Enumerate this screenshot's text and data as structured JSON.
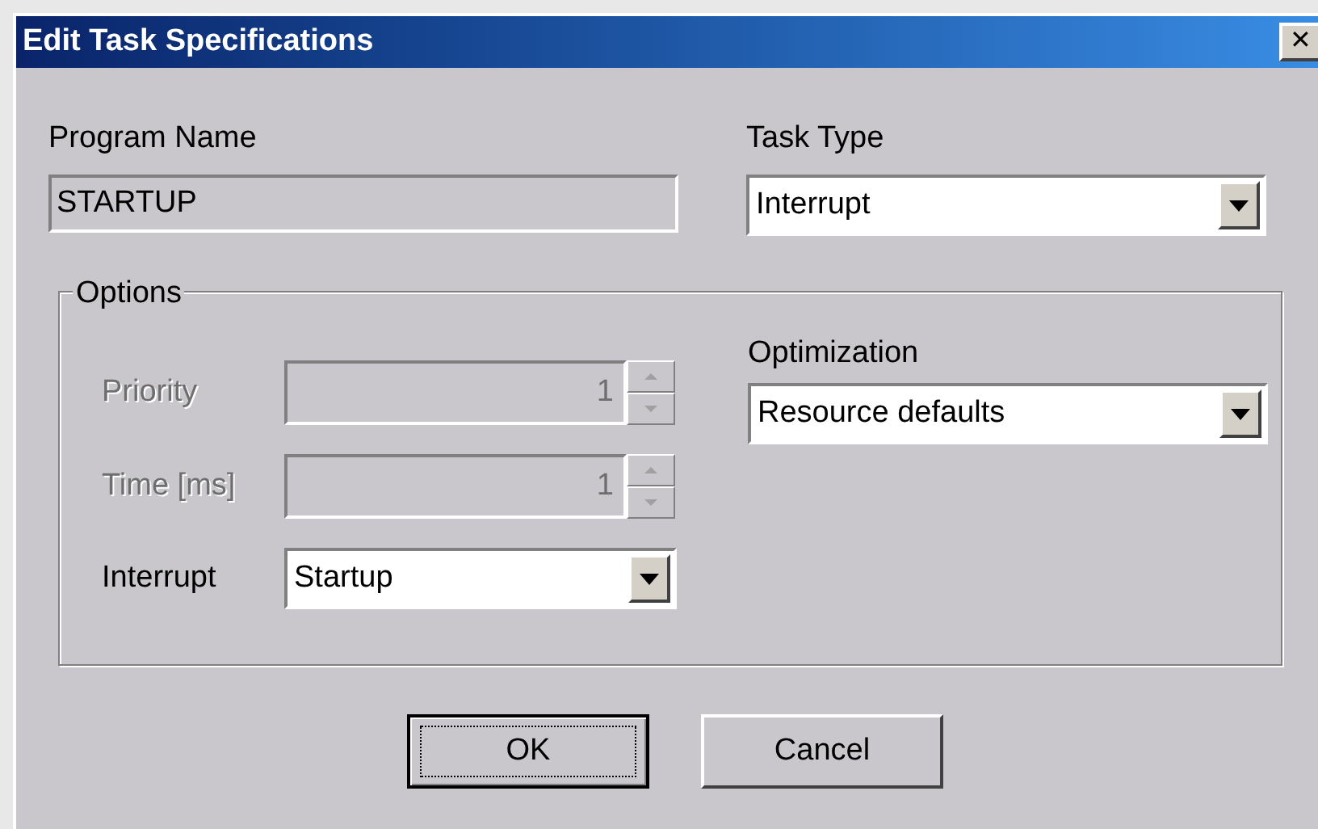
{
  "window": {
    "title": "Edit Task Specifications",
    "close": "✕"
  },
  "program_name": {
    "label": "Program Name",
    "value": "STARTUP"
  },
  "task_type": {
    "label": "Task Type",
    "value": "Interrupt"
  },
  "options": {
    "title": "Options",
    "spinners": [
      {
        "label": "Priority",
        "value": "1",
        "disabled": true
      },
      {
        "label": "Time [ms]",
        "value": "1",
        "disabled": true
      }
    ],
    "interrupt": {
      "label": "Interrupt",
      "value": "Startup"
    },
    "optimization": {
      "label": "Optimization",
      "value": "Resource defaults"
    }
  },
  "buttons": [
    {
      "label": "OK",
      "default": true
    },
    {
      "label": "Cancel",
      "default": false
    }
  ]
}
